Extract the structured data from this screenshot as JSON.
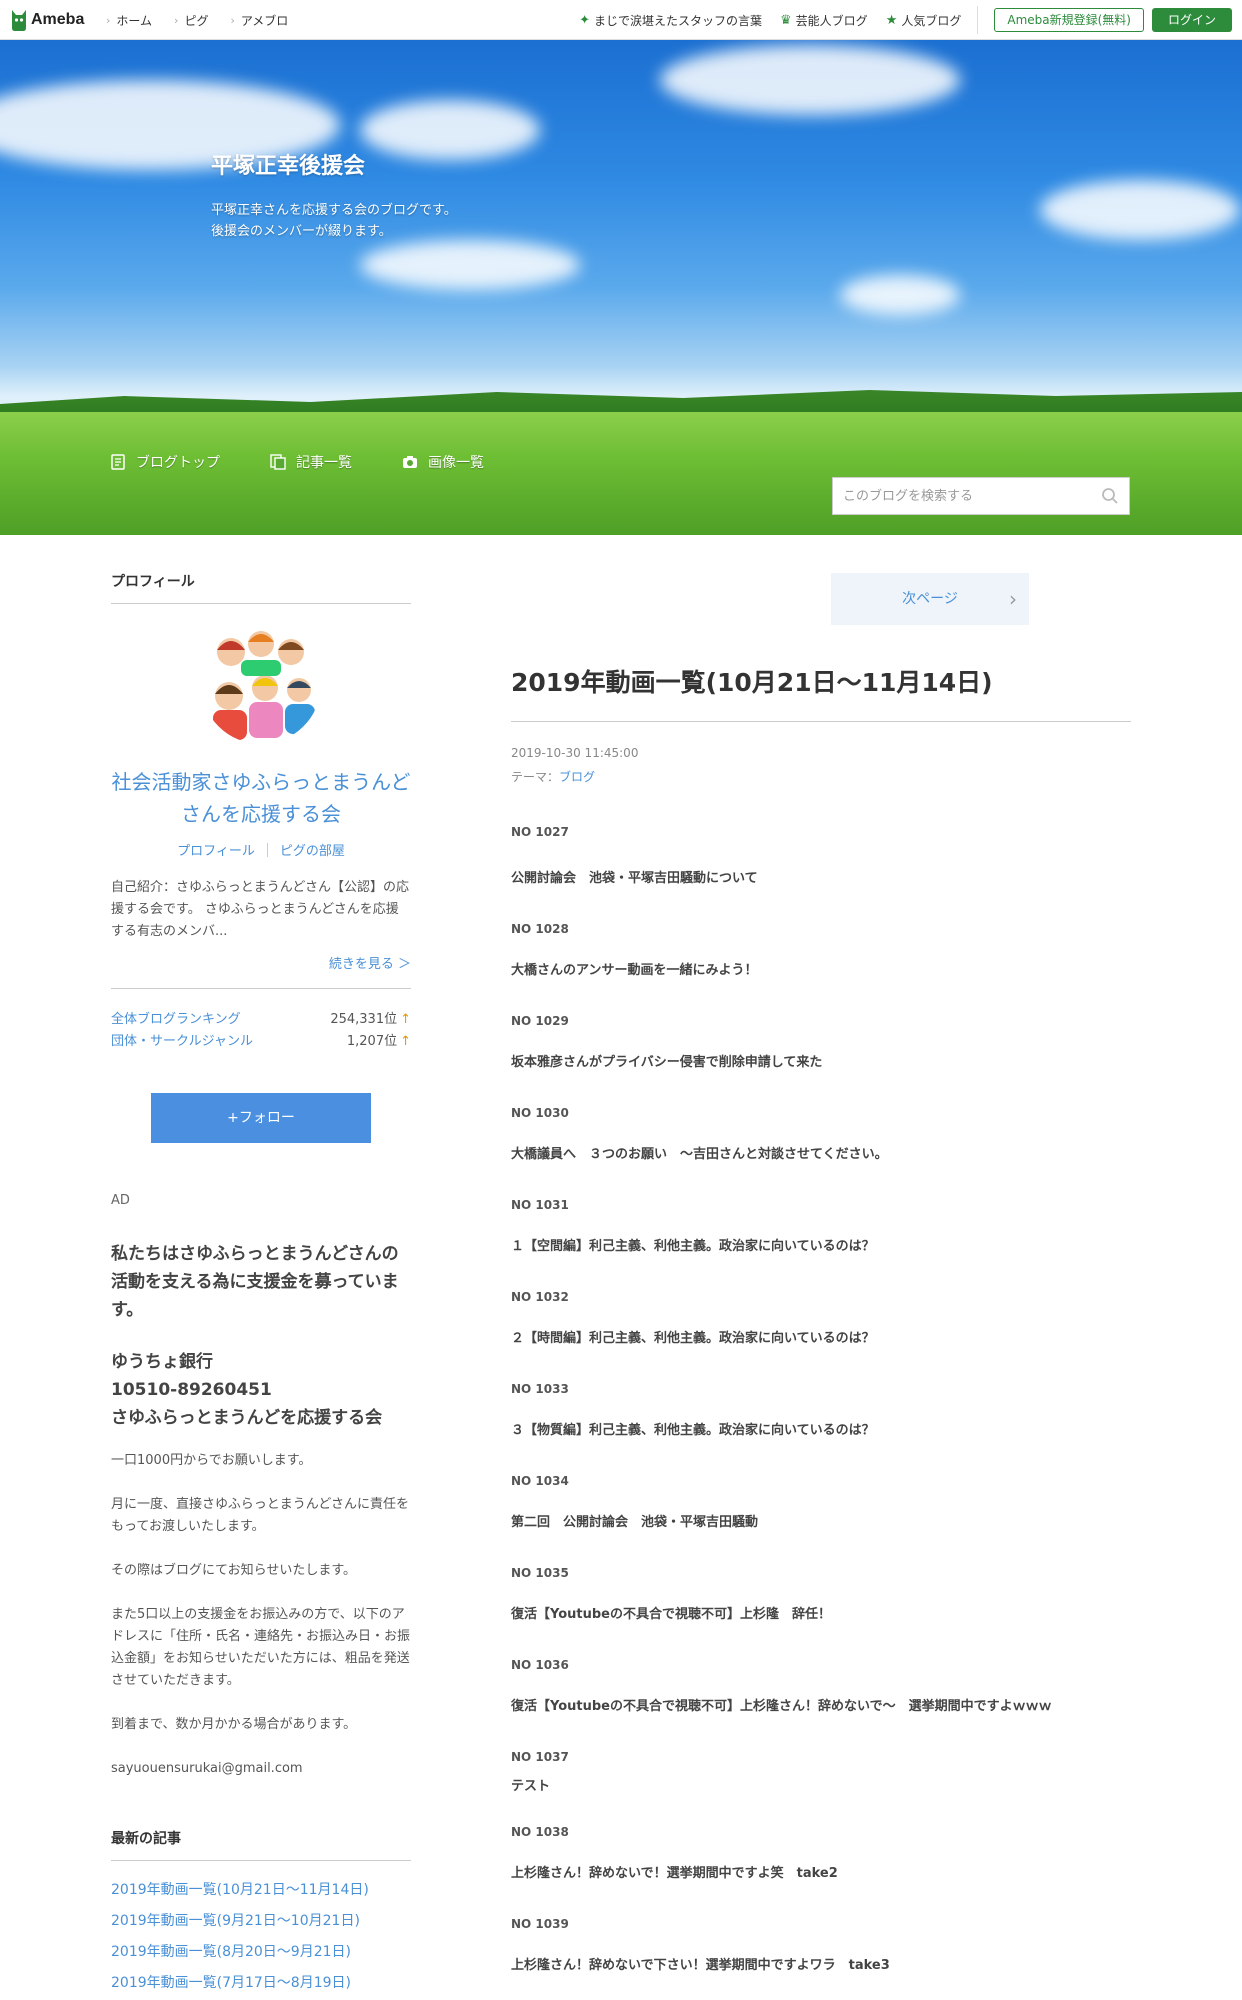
{
  "topbar": {
    "logo": "Ameba",
    "nav": [
      "ホーム",
      "ピグ",
      "アメブロ"
    ],
    "right_links": [
      {
        "label": "まじで涙堪えたスタッフの言葉",
        "icon": "sparkle-icon"
      },
      {
        "label": "芸能人ブログ",
        "icon": "crown-icon"
      },
      {
        "label": "人気ブログ",
        "icon": "star-icon"
      }
    ],
    "register": "Ameba新規登録(無料)",
    "login": "ログイン"
  },
  "header": {
    "title": "平塚正幸後援会",
    "description": "平塚正幸さんを応援する会のブログです。\n後援会のメンバーが綴ります。",
    "nav": [
      {
        "label": "ブログトップ",
        "icon": "document-icon"
      },
      {
        "label": "記事一覧",
        "icon": "list-icon"
      },
      {
        "label": "画像一覧",
        "icon": "camera-icon"
      }
    ],
    "search_placeholder": "このブログを検索する"
  },
  "sidebar": {
    "profile_heading": "プロフィール",
    "profile_name": "社会活動家さゆふらっとまうんどさんを応援する会",
    "profile_link1": "プロフィール",
    "profile_link2": "ピグの部屋",
    "intro": "自己紹介：さゆふらっとまうんどさん【公認】の応援する会です。 さゆふらっとまうんどさんを応援する有志のメンバ...",
    "more": "続きを見る ＞",
    "rankings": [
      {
        "label": "全体ブログランキング",
        "value": "254,331位"
      },
      {
        "label": "団体・サークルジャンル",
        "value": "1,207位"
      }
    ],
    "rank_arrow": "↑",
    "follow": "+フォロー",
    "ad_label": "AD",
    "ad_big1": "私たちはさゆふらっとまうんどさんの活動を支える為に支援金を募っています。",
    "ad_big2": "ゆうちょ銀行\n10510-89260451\nさゆふらっとまうんどを応援する会",
    "ad_p1": "一口1000円からでお願いします。",
    "ad_p2": "月に一度、直接さゆふらっとまうんどさんに責任をもってお渡しいたします。",
    "ad_p3": "その際はブログにてお知らせいたします。",
    "ad_p4": "また5口以上の支援金をお振込みの方で、以下のアドレスに「住所・氏名・連絡先・お振込み日・お振込金額」をお知らせいただいた方には、粗品を発送させていただきます。",
    "ad_p5": "到着まで、数か月かかる場合があります。",
    "email": "sayuouensurukai@gmail.com",
    "latest_heading": "最新の記事",
    "latest": [
      "2019年動画一覧(10月21日〜11月14日)",
      "2019年動画一覧(9月21日〜10月21日)",
      "2019年動画一覧(8月20日〜9月21日)",
      "2019年動画一覧(7月17日〜8月19日)"
    ]
  },
  "main": {
    "next_page": "次ページ",
    "title": "2019年動画一覧(10月21日〜11月14日)",
    "date": "2019-10-30 11:45:00",
    "theme_label": "テーマ：",
    "theme": "ブログ",
    "entries": [
      {
        "no": "NO 1027",
        "title": "公開討論会　池袋・平塚吉田騒動について"
      },
      {
        "no": "NO 1028",
        "title": "大橋さんのアンサー動画を一緒にみよう！"
      },
      {
        "no": "NO 1029",
        "title": "坂本雅彦さんがプライバシー侵害で削除申請して来た"
      },
      {
        "no": "NO 1030",
        "title": "大橋議員へ　３つのお願い　～吉田さんと対談させてください。"
      },
      {
        "no": "NO 1031",
        "title": "１【空間編】利己主義、利他主義。政治家に向いているのは？"
      },
      {
        "no": "NO 1032",
        "title": "２【時間編】利己主義、利他主義。政治家に向いているのは？"
      },
      {
        "no": "NO 1033",
        "title": "３【物質編】利己主義、利他主義。政治家に向いているのは？"
      },
      {
        "no": "NO 1034",
        "title": "第二回　公開討論会　池袋・平塚吉田騒動"
      },
      {
        "no": "NO 1035",
        "title": "復活【Youtubeの不具合で視聴不可】上杉隆　辞任！"
      },
      {
        "no": "NO 1036",
        "title": "復活【Youtubeの不具合で視聴不可】上杉隆さん！辞めないで～　選挙期間中ですよｗｗｗ"
      },
      {
        "no": "NO 1037",
        "title": "テスト"
      },
      {
        "no": "NO 1038",
        "title": "上杉隆さん！辞めないで！選挙期間中ですよ笑　take2"
      },
      {
        "no": "NO 1039",
        "title": "上杉隆さん！辞めないで下さい！選挙期間中ですよワラ　take3"
      }
    ]
  }
}
